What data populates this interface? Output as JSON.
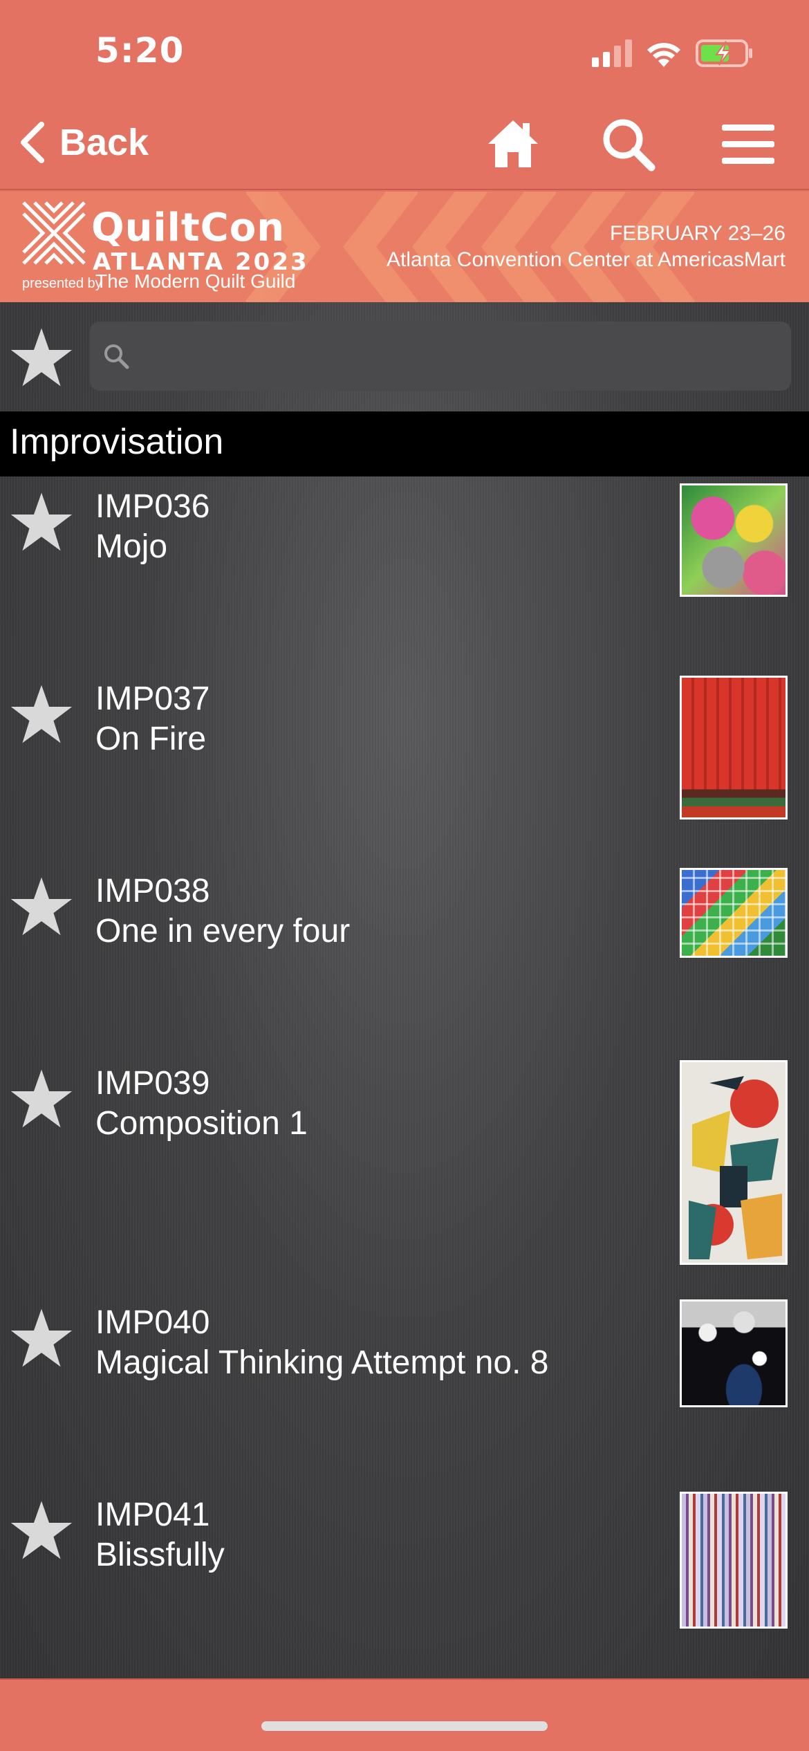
{
  "status": {
    "time": "5:20"
  },
  "nav": {
    "back_label": "Back"
  },
  "banner": {
    "title": "QuiltCon",
    "subtitle": "ATLANTA 2023",
    "presented": "presented by",
    "guild": "The Modern Quilt Guild",
    "dates": "FEBRUARY 23–26",
    "venue": "Atlanta Convention Center at AmericasMart"
  },
  "search": {
    "value": "",
    "placeholder": ""
  },
  "section": {
    "title": "Improvisation"
  },
  "items": [
    {
      "code": "IMP036",
      "title": "Mojo"
    },
    {
      "code": "IMP037",
      "title": "On Fire"
    },
    {
      "code": "IMP038",
      "title": "One in every four"
    },
    {
      "code": "IMP039",
      "title": "Composition 1"
    },
    {
      "code": "IMP040",
      "title": "Magical Thinking Attempt no. 8"
    },
    {
      "code": "IMP041",
      "title": "Blissfully"
    }
  ],
  "colors": {
    "accent": "#e47262",
    "banner": "#ea7d65",
    "list_bg": "#414143",
    "star": "#d9d9d9"
  }
}
